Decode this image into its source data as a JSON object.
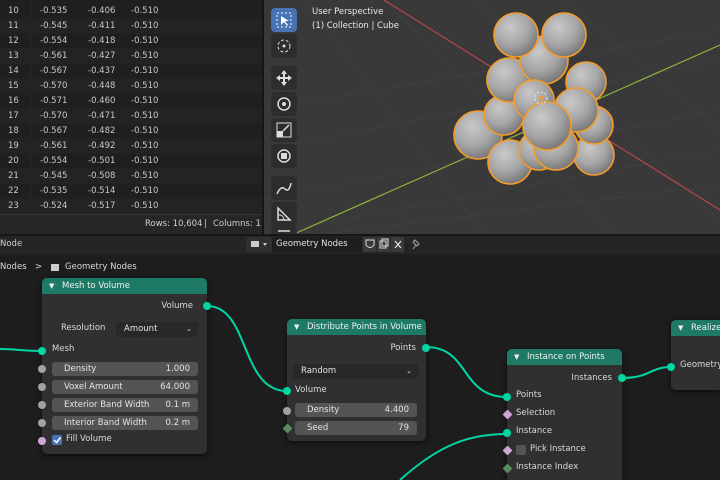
{
  "spreadsheet": {
    "rows": [
      {
        "index": "10",
        "a": "-0.535",
        "b": "-0.406",
        "c": "-0.510"
      },
      {
        "index": "11",
        "a": "-0.545",
        "b": "-0.411",
        "c": "-0.510"
      },
      {
        "index": "12",
        "a": "-0.554",
        "b": "-0.418",
        "c": "-0.510"
      },
      {
        "index": "13",
        "a": "-0.561",
        "b": "-0.427",
        "c": "-0.510"
      },
      {
        "index": "14",
        "a": "-0.567",
        "b": "-0.437",
        "c": "-0.510"
      },
      {
        "index": "15",
        "a": "-0.570",
        "b": "-0.448",
        "c": "-0.510"
      },
      {
        "index": "16",
        "a": "-0.571",
        "b": "-0.460",
        "c": "-0.510"
      },
      {
        "index": "17",
        "a": "-0.570",
        "b": "-0.471",
        "c": "-0.510"
      },
      {
        "index": "18",
        "a": "-0.567",
        "b": "-0.482",
        "c": "-0.510"
      },
      {
        "index": "19",
        "a": "-0.561",
        "b": "-0.492",
        "c": "-0.510"
      },
      {
        "index": "20",
        "a": "-0.554",
        "b": "-0.501",
        "c": "-0.510"
      },
      {
        "index": "21",
        "a": "-0.545",
        "b": "-0.508",
        "c": "-0.510"
      },
      {
        "index": "22",
        "a": "-0.535",
        "b": "-0.514",
        "c": "-0.510"
      },
      {
        "index": "23",
        "a": "-0.524",
        "b": "-0.517",
        "c": "-0.510"
      }
    ],
    "footer": {
      "rows": "Rows: 10,604",
      "sep": "|",
      "columns": "Columns: 1"
    }
  },
  "viewport": {
    "perspective": "User Perspective",
    "collection": "(1) Collection | Cube",
    "tools": [
      "select-box-icon",
      "cursor-icon",
      "move-icon",
      "rotate-icon",
      "scale-icon",
      "transform-icon",
      "annotate-icon",
      "measure-icon",
      "add-cube-icon"
    ]
  },
  "node_editor": {
    "header": {
      "menu": "Node",
      "tree_name": "Geometry Nodes"
    },
    "breadcrumb": {
      "parent": "Nodes",
      "sep": ">",
      "current": "Geometry Nodes"
    },
    "colors": {
      "geometry_header": "#1e7a64",
      "geometry_socket": "#00d6a3",
      "link": "#00d6a3"
    },
    "mesh_to_volume": {
      "title": "Mesh to Volume",
      "out_volume": "Volume",
      "resolution_label": "Resolution",
      "resolution_value": "Amount",
      "in_mesh": "Mesh",
      "density_label": "Density",
      "density_value": "1.000",
      "voxel_label": "Voxel Amount",
      "voxel_value": "64.000",
      "ext_label": "Exterior Band Width",
      "ext_value": "0.1 m",
      "int_label": "Interior Band Width",
      "int_value": "0.2 m",
      "fill_label": "Fill Volume",
      "fill_checked": true
    },
    "distribute": {
      "title": "Distribute Points in Volume",
      "out_points": "Points",
      "mode": "Random",
      "in_volume": "Volume",
      "density_label": "Density",
      "density_value": "4.400",
      "seed_label": "Seed",
      "seed_value": "79"
    },
    "instance_on_points": {
      "title": "Instance on Points",
      "out_instances": "Instances",
      "in_points": "Points",
      "in_selection": "Selection",
      "in_instance": "Instance",
      "pick_label": "Pick Instance",
      "pick_checked": false,
      "in_index": "Instance Index"
    },
    "realize": {
      "title": "Realize",
      "in_geometry": "Geometry"
    }
  }
}
